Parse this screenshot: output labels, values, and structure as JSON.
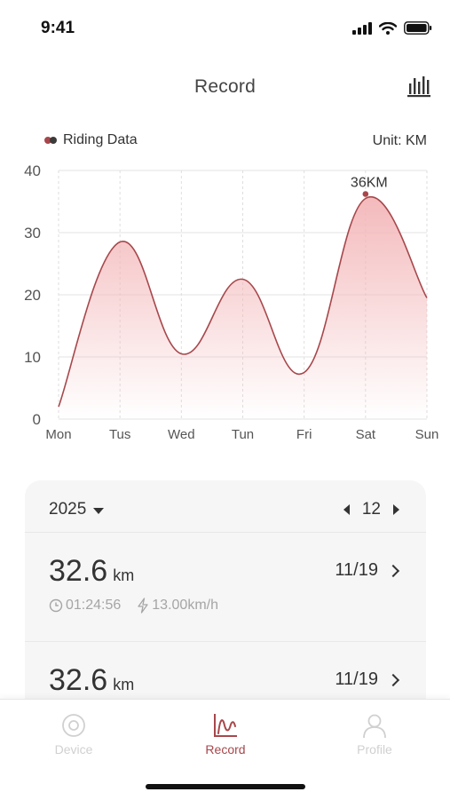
{
  "status_bar": {
    "time": "9:41"
  },
  "header": {
    "title": "Record",
    "stats_icon": "bar-chart-icon"
  },
  "chart_header": {
    "legend": "Riding Data",
    "unit": "Unit: KM"
  },
  "chart_data": {
    "type": "area",
    "categories": [
      "Mon",
      "Tus",
      "Wed",
      "Tun",
      "Fri",
      "Sat",
      "Sun"
    ],
    "series": [
      {
        "name": "Riding Data",
        "values": [
          2,
          28.5,
          10.5,
          22.5,
          7.5,
          35.5,
          19.5
        ]
      }
    ],
    "yticks": [
      "0",
      "10",
      "20",
      "30",
      "40"
    ],
    "ylim": [
      0,
      40
    ],
    "annotation": {
      "category": "Sat",
      "label": "36KM"
    },
    "grid": true,
    "colors": {
      "line": "#a7474b",
      "fill": "#f3b6b8",
      "grid": "#e3e3e3"
    }
  },
  "records": {
    "year": "2025",
    "month": "12",
    "items": [
      {
        "distance": "32.6",
        "unit": "km",
        "date": "11/19",
        "duration": "01:24:56",
        "speed": "13.00km/h"
      },
      {
        "distance": "32.6",
        "unit": "km",
        "date": "11/19"
      }
    ]
  },
  "tabbar": {
    "tabs": [
      {
        "label": "Device",
        "icon": "device-icon"
      },
      {
        "label": "Record",
        "icon": "record-icon"
      },
      {
        "label": "Profile",
        "icon": "profile-icon"
      }
    ],
    "active": "Record"
  },
  "colors": {
    "accent": "#a7474b",
    "inactive": "#d0d0d0",
    "card_bg": "#f6f6f6"
  }
}
